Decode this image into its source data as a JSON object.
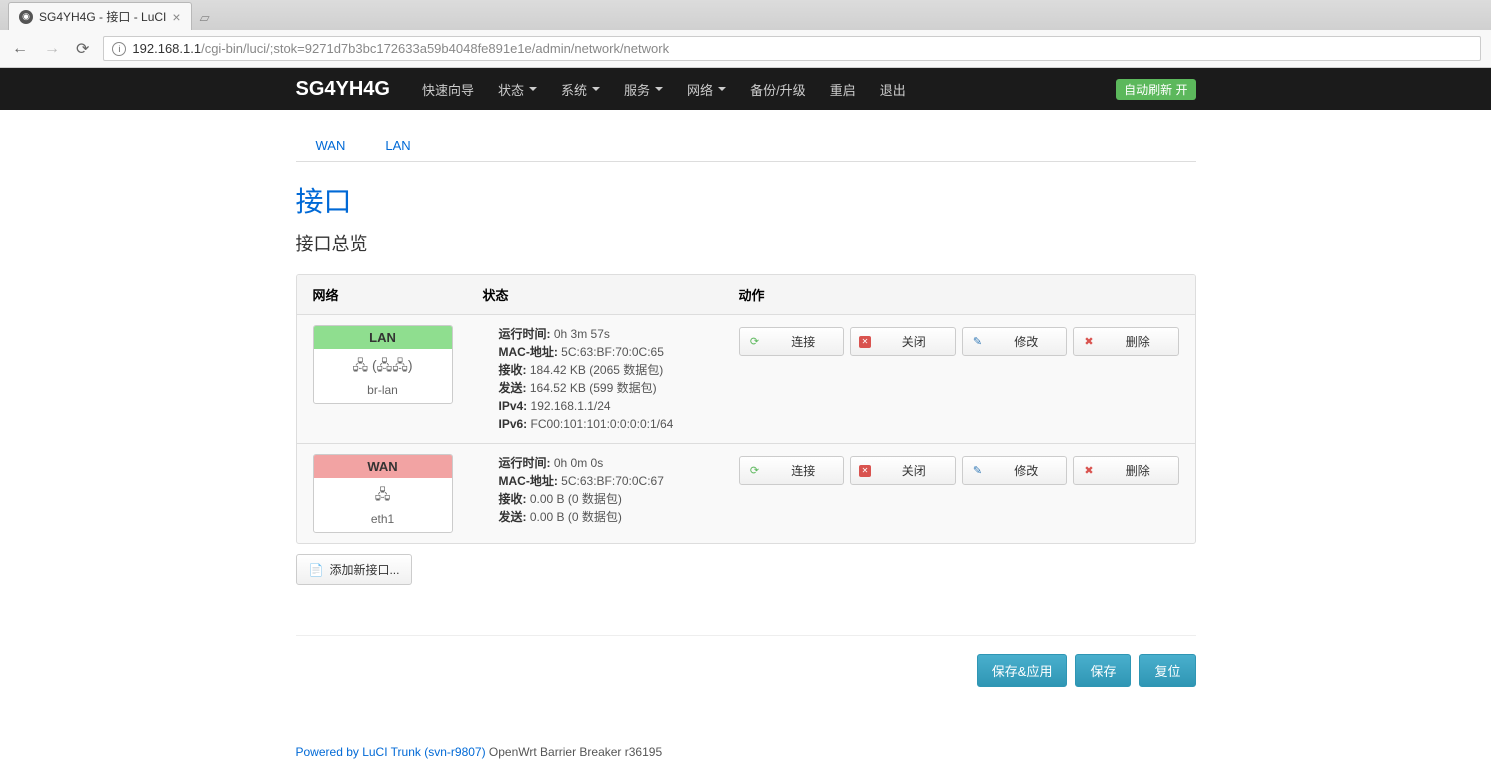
{
  "browser": {
    "tab_title": "SG4YH4G - 接口 - LuCI",
    "url_host": "192.168.1.1",
    "url_path": "/cgi-bin/luci/;stok=9271d7b3bc172633a59b4048fe891e1e/admin/network/network"
  },
  "navbar": {
    "brand": "SG4YH4G",
    "menu": [
      "快速向导",
      "状态",
      "系统",
      "服务",
      "网络",
      "备份/升级",
      "重启",
      "退出"
    ],
    "menu_has_dropdown": [
      false,
      true,
      true,
      true,
      true,
      false,
      false,
      false
    ],
    "auto_refresh": "自动刷新 开"
  },
  "tabs": [
    "WAN",
    "LAN"
  ],
  "page_title": "接口",
  "section_title": "接口总览",
  "columns": {
    "network": "网络",
    "status": "状态",
    "actions": "动作"
  },
  "action_labels": {
    "connect": "连接",
    "stop": "关闭",
    "edit": "修改",
    "delete": "删除"
  },
  "interfaces": [
    {
      "name": "LAN",
      "class": "lan",
      "dev": "br-lan",
      "icon_text": "🖧 (🖧🖧)",
      "status": [
        {
          "label": "运行时间:",
          "value": "0h 3m 57s"
        },
        {
          "label": "MAC-地址:",
          "value": "5C:63:BF:70:0C:65"
        },
        {
          "label": "接收:",
          "value": "184.42 KB (2065 数据包)"
        },
        {
          "label": "发送:",
          "value": "164.52 KB (599 数据包)"
        },
        {
          "label": "IPv4:",
          "value": "192.168.1.1/24"
        },
        {
          "label": "IPv6:",
          "value": "FC00:101:101:0:0:0:0:1/64"
        }
      ]
    },
    {
      "name": "WAN",
      "class": "wan",
      "dev": "eth1",
      "icon_text": "🖧",
      "status": [
        {
          "label": "运行时间:",
          "value": "0h 0m 0s"
        },
        {
          "label": "MAC-地址:",
          "value": "5C:63:BF:70:0C:67"
        },
        {
          "label": "接收:",
          "value": "0.00 B (0 数据包)"
        },
        {
          "label": "发送:",
          "value": "0.00 B (0 数据包)"
        }
      ]
    }
  ],
  "add_interface": "添加新接口...",
  "form_buttons": {
    "save_apply": "保存&应用",
    "save": "保存",
    "reset": "复位"
  },
  "footer": {
    "link": "Powered by LuCI Trunk (svn-r9807)",
    "text": " OpenWrt Barrier Breaker r36195"
  }
}
